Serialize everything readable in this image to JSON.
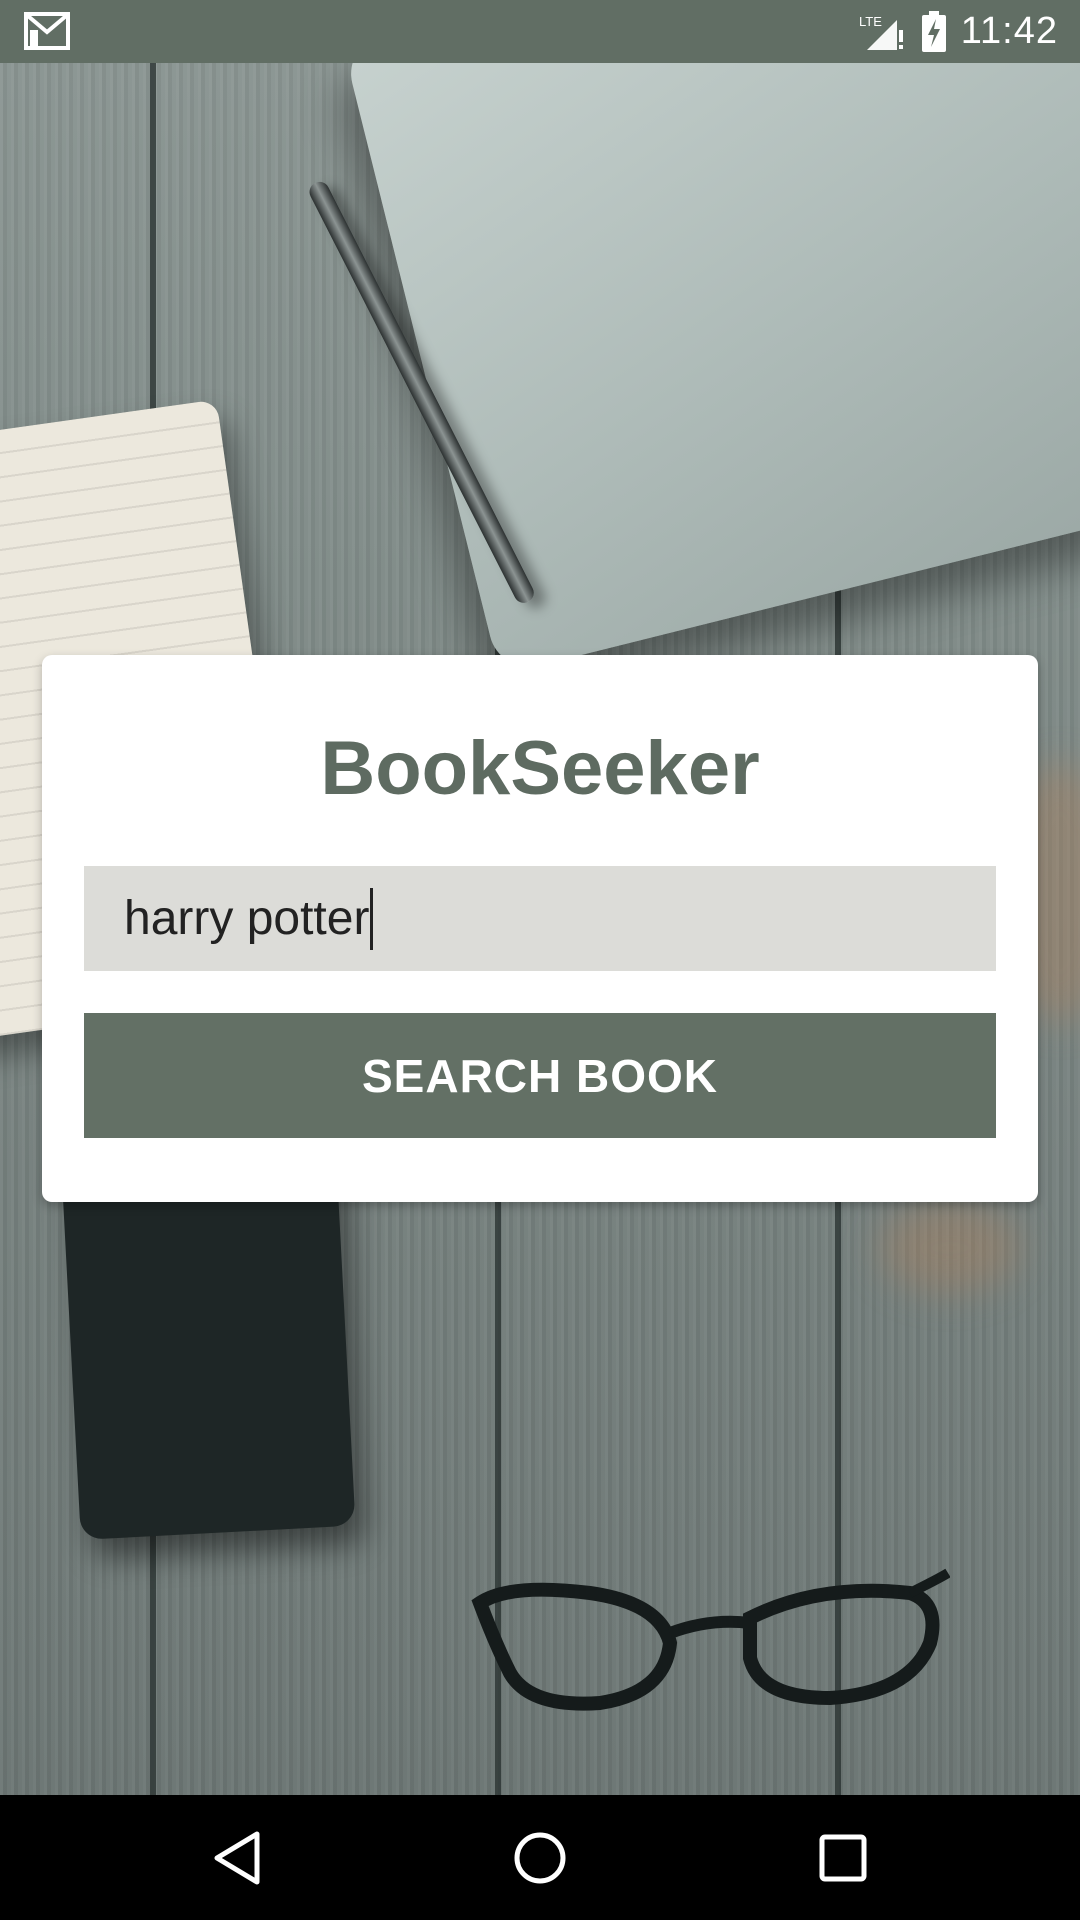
{
  "status_bar": {
    "time": "11:42",
    "network": "LTE",
    "icons": [
      "gmail-icon",
      "signal-icon",
      "battery-charging-icon"
    ]
  },
  "app": {
    "title": "BookSeeker",
    "search": {
      "value": "harry potter"
    },
    "button_label": "SEARCH BOOK"
  },
  "nav_bar": {
    "icons": [
      "back-icon",
      "home-icon",
      "recents-icon"
    ]
  },
  "colors": {
    "accent": "#637065",
    "title": "#5e6b61",
    "input_bg": "#dcdcd8",
    "status_bar": "#616e64"
  }
}
